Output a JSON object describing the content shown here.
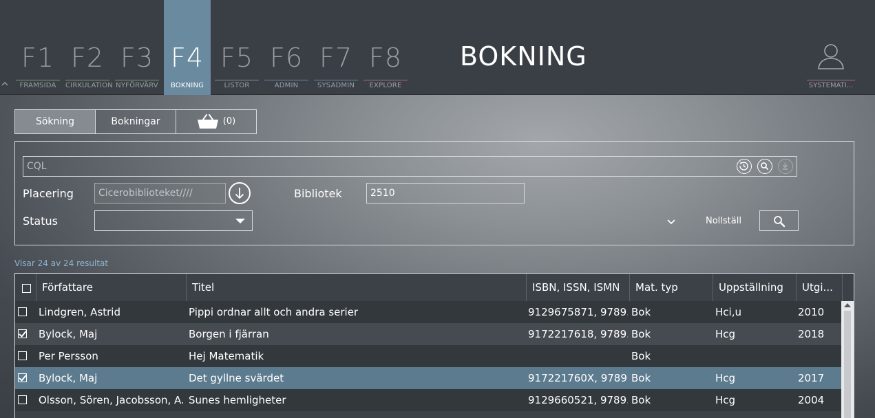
{
  "nav": {
    "fkeys": [
      {
        "key": "F1",
        "label": "FRAMSIDA"
      },
      {
        "key": "F2",
        "label": "CIRKULATION"
      },
      {
        "key": "F3",
        "label": "NYFÖRVÄRV"
      },
      {
        "key": "F4",
        "label": "BOKNING"
      },
      {
        "key": "F5",
        "label": "LISTOR"
      },
      {
        "key": "F6",
        "label": "ADMIN"
      },
      {
        "key": "F7",
        "label": "SYSADMIN"
      },
      {
        "key": "F8",
        "label": "EXPLORE"
      }
    ],
    "active": "F4",
    "page_title": "BOKNING",
    "user_label": "SYSTEMATI...",
    "collapse_icon": "chevron-up-icon"
  },
  "subtabs": {
    "search": "Sökning",
    "bookings": "Bokningar",
    "cart_count": "(0)",
    "cart_icon": "basket-icon"
  },
  "search": {
    "cql_placeholder": "CQL",
    "placering_label": "Placering",
    "placering_placeholder": "Cicerobiblioteket////",
    "bibliotek_label": "Bibliotek",
    "bibliotek_value": "2510",
    "status_label": "Status",
    "status_value": "",
    "reset_label": "Nollställ"
  },
  "results": {
    "count_text": "Visar 24 av 24 resultat",
    "columns": [
      "Författare",
      "Titel",
      "ISBN, ISSN, ISMN",
      "Mat. typ",
      "Uppställning",
      "Utgi..."
    ],
    "rows": [
      {
        "checked": false,
        "author": "Lindgren, Astrid",
        "title": "Pippi ordnar allt och andra serier",
        "isbn": "9129675871, 9789...",
        "type": "Bok",
        "shelf": "Hci,u",
        "year": "2010"
      },
      {
        "checked": true,
        "author": "Bylock, Maj",
        "title": "Borgen i fjärran",
        "isbn": "9172217618, 9789...",
        "type": "Bok",
        "shelf": "Hcg",
        "year": "2018"
      },
      {
        "checked": false,
        "author": "Per Persson",
        "title": "Hej Matematik",
        "isbn": "",
        "type": "Bok",
        "shelf": "",
        "year": ""
      },
      {
        "checked": true,
        "author": "Bylock, Maj",
        "title": "Det gyllne svärdet",
        "isbn": "917221760X, 9789...",
        "type": "Bok",
        "shelf": "Hcg",
        "year": "2017"
      },
      {
        "checked": false,
        "author": "Olsson, Sören, Jacobsson, A...",
        "title": "Sunes hemligheter",
        "isbn": "9129660521, 9789...",
        "type": "Bok",
        "shelf": "Hcg",
        "year": "2004"
      }
    ]
  },
  "colors": {
    "topbar": "#3a3f45",
    "active_tab": "#6a8aa0",
    "selected_row": "#5d7b8f",
    "result_count": "#8fb4cf"
  }
}
